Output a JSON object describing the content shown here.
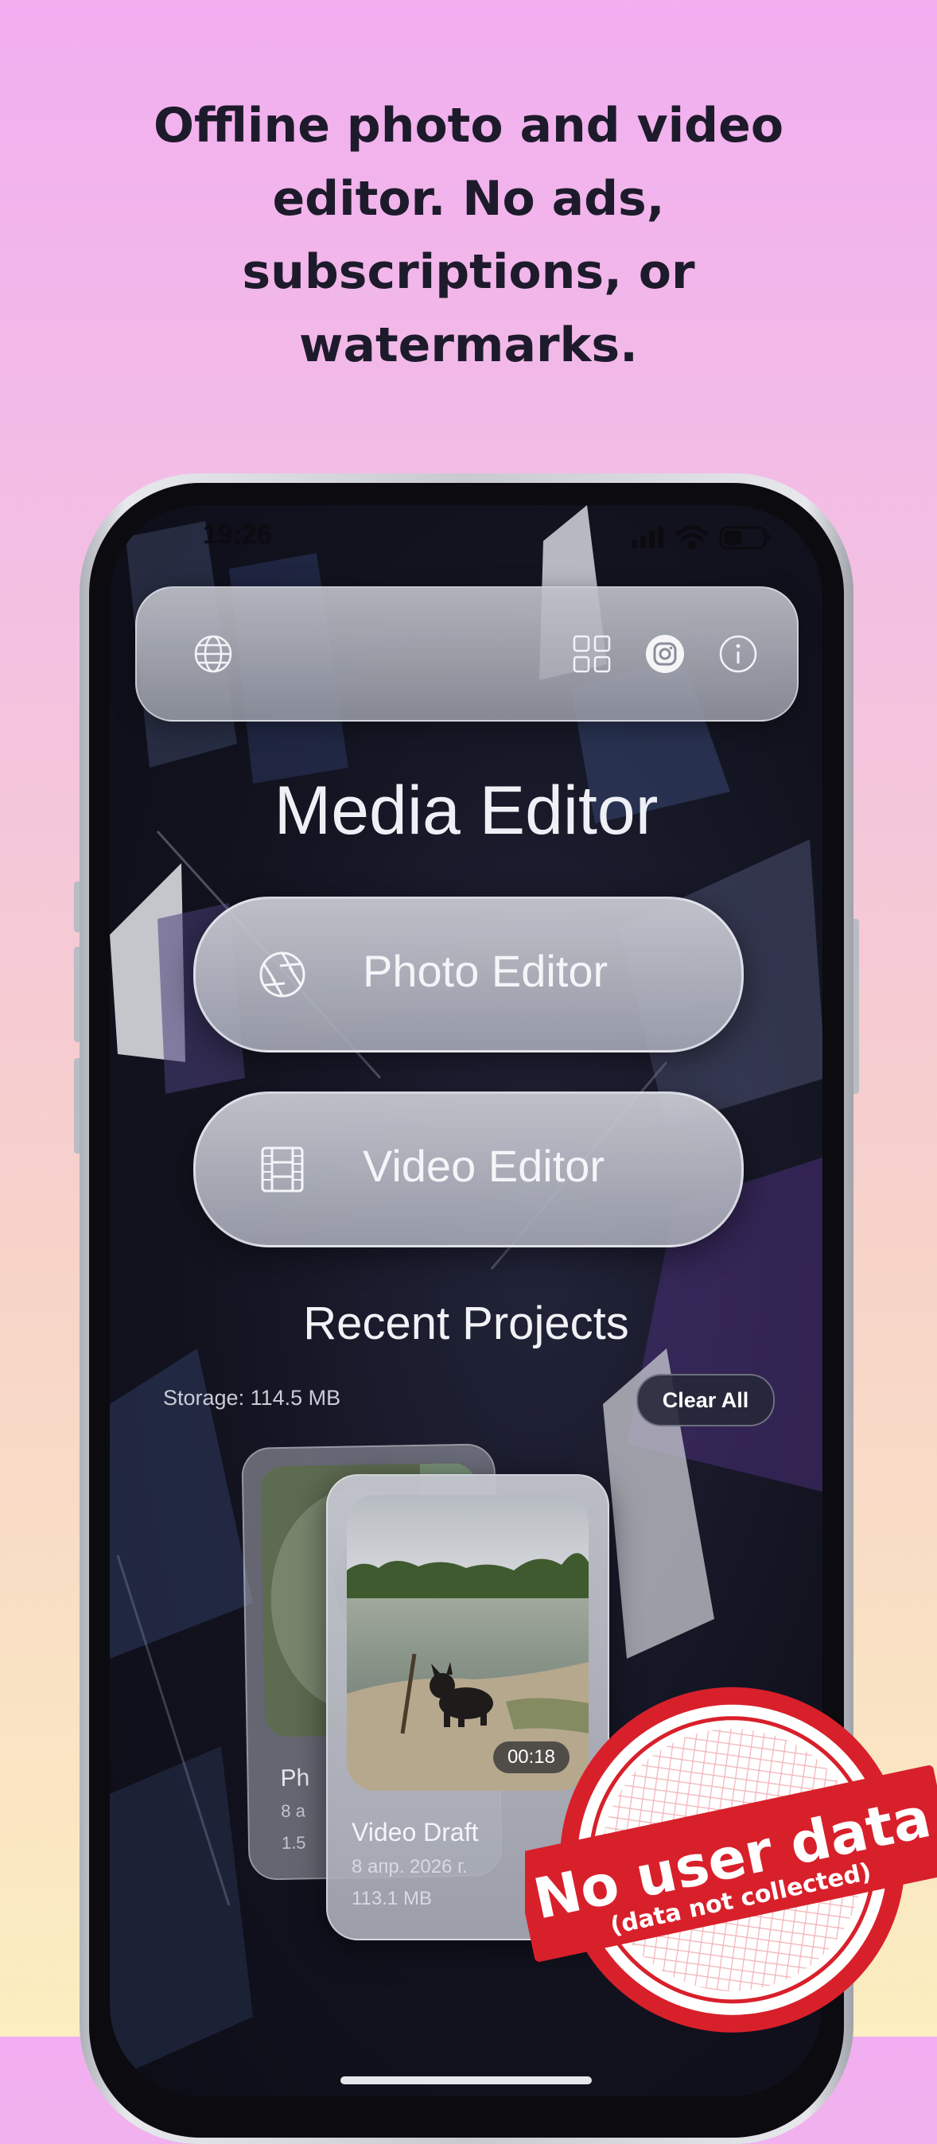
{
  "promo": {
    "headline": "Offline photo and video editor. No ads, subscriptions, or watermarks."
  },
  "status_bar": {
    "time": "19:26"
  },
  "toolbar": {
    "icons": [
      "globe-icon",
      "grid-icon",
      "instagram-icon",
      "info-icon"
    ]
  },
  "app": {
    "title": "Media Editor",
    "photo_button": {
      "label": "Photo Editor",
      "icon": "aperture-icon"
    },
    "video_button": {
      "label": "Video Editor",
      "icon": "film-strip-icon"
    }
  },
  "recent": {
    "title": "Recent Projects",
    "storage": "Storage: 114.5 MB",
    "clear_label": "Clear All",
    "back_card": {
      "title_partial": "Ph",
      "line1_partial": "8 а",
      "line2_partial": "1.5"
    },
    "front_card": {
      "title": "Video Draft",
      "date": "8 апр. 2026 г.",
      "size": "113.1 MB",
      "duration": "00:18"
    }
  },
  "stamp": {
    "main": "No user data",
    "sub": "(data not collected)",
    "color": "#d8202b"
  },
  "colors": {
    "bg_top": "#f1aef0",
    "bg_bottom": "#fbeec0",
    "screen_bg": "#12131f"
  }
}
